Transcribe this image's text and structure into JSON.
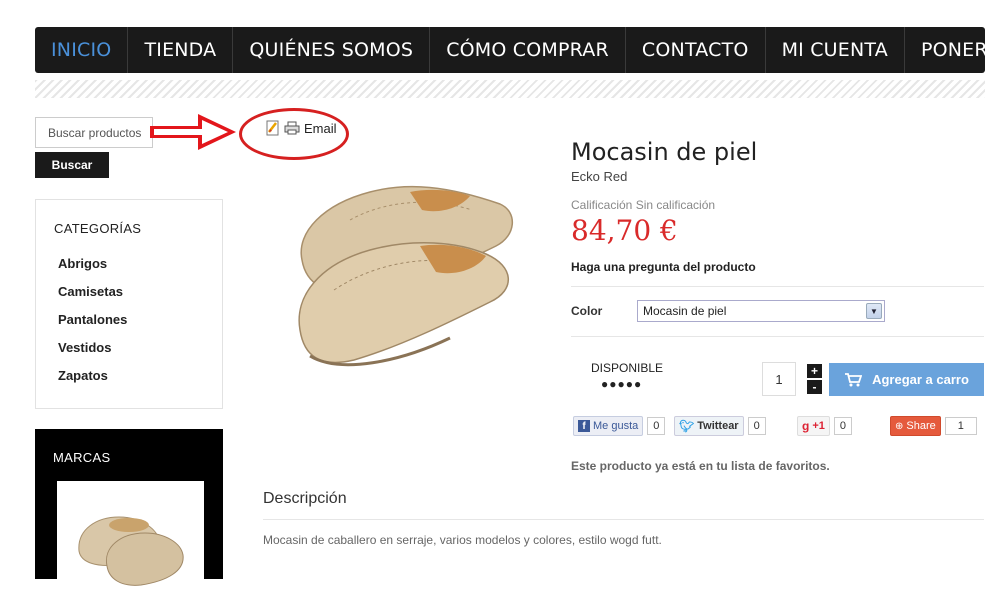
{
  "nav": {
    "items": [
      "INICIO",
      "TIENDA",
      "QUIÉNES SOMOS",
      "CÓMO COMPRAR",
      "CONTACTO",
      "MI CUENTA",
      "PONER"
    ],
    "active_index": 0,
    "cart_icon": "cart-icon",
    "accent": "#4a90d9"
  },
  "sidebar": {
    "search_placeholder": "Buscar productos",
    "search_button": "Buscar",
    "categories_title": "CATEGORÍAS",
    "categories": [
      "Abrigos",
      "Camisetas",
      "Pantalones",
      "Vestidos",
      "Zapatos"
    ],
    "brands_title": "MARCAS"
  },
  "tools": {
    "email_label": "Email",
    "icons": [
      "pdf-icon",
      "print-icon"
    ]
  },
  "product": {
    "title": "Mocasin de piel",
    "brand": "Ecko Red",
    "rating": "Calificación Sin calificación",
    "price": "84,70 €",
    "price_color": "#d92a2a",
    "question": "Haga una pregunta del producto",
    "color_label": "Color",
    "color_selected": "Mocasin de piel",
    "availability": "DISPONIBLE",
    "availability_dots": "●●●●●",
    "quantity": "1",
    "add_to_cart": "Agregar a carro",
    "favorites_msg": "Este producto ya está en tu lista de favoritos."
  },
  "social": {
    "like_label": "Me gusta",
    "like_count": "0",
    "tweet_label": "Twittear",
    "tweet_count": "0",
    "gplus_label": "+1",
    "gplus_count": "0",
    "share_label": "Share",
    "share_count": "1"
  },
  "description": {
    "title": "Descripción",
    "text": "Mocasin de caballero en serraje, varios modelos y colores, estilo wogd futt."
  }
}
